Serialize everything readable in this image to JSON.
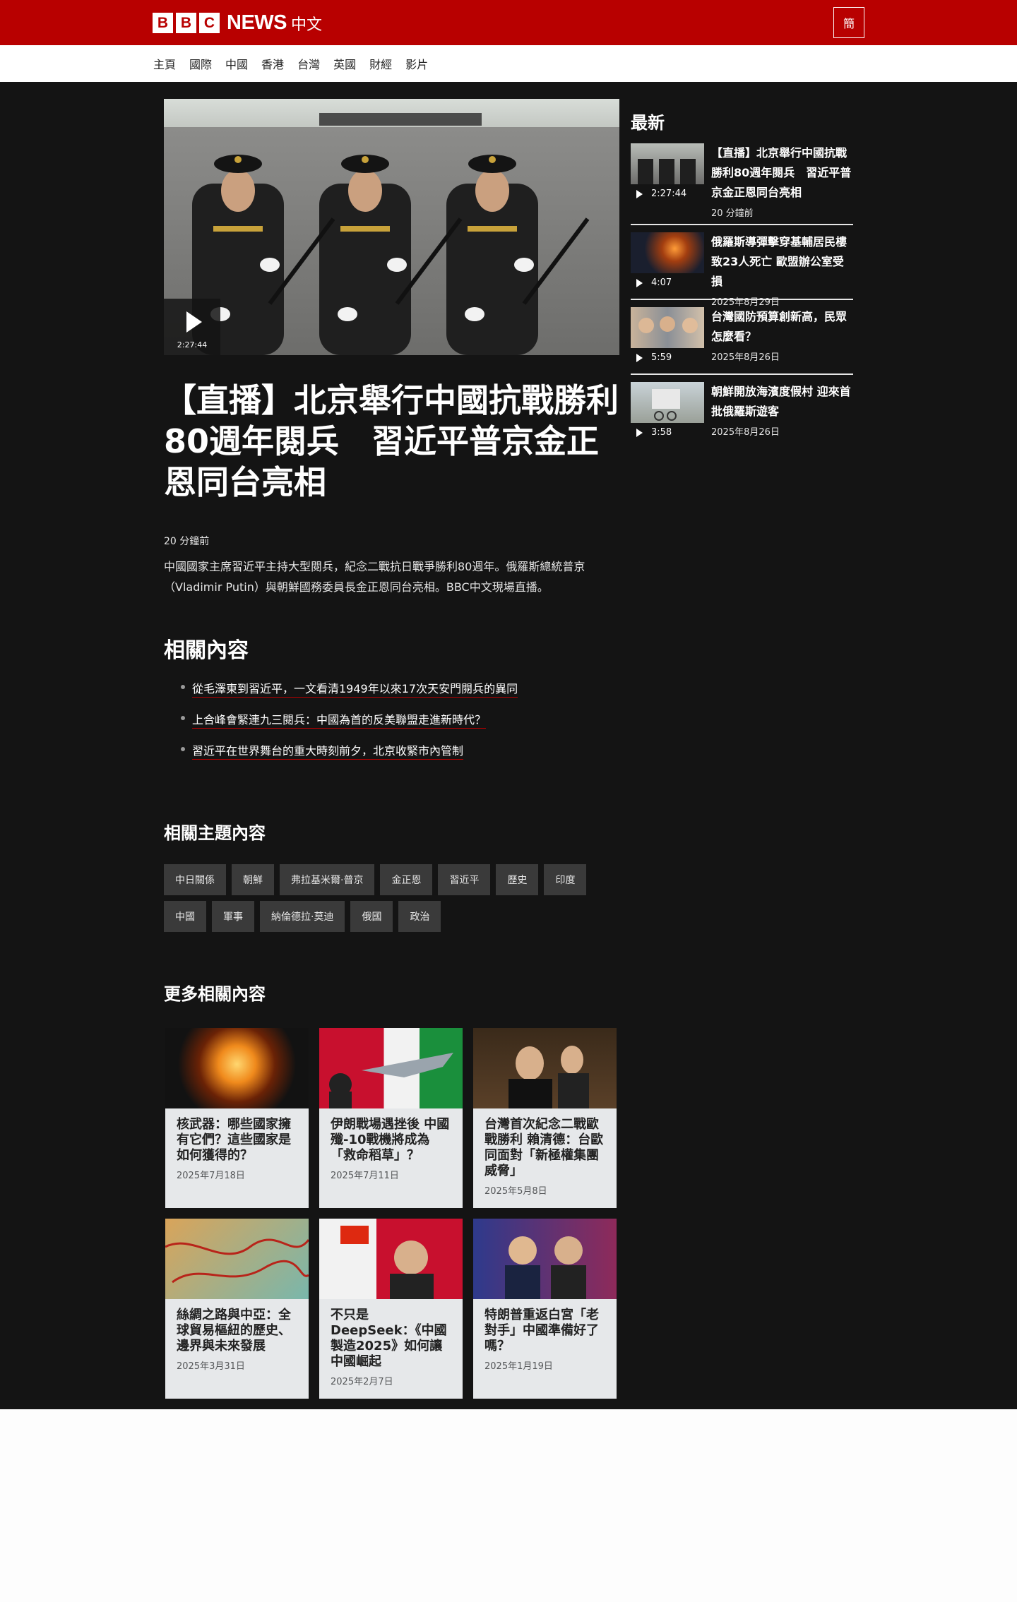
{
  "header": {
    "brand_letters": [
      "B",
      "B",
      "C"
    ],
    "brand_news": "NEWS",
    "brand_lang": "中文",
    "script_toggle": "簡"
  },
  "nav": {
    "items": [
      "主頁",
      "國際",
      "中國",
      "香港",
      "台灣",
      "英國",
      "財經",
      "影片"
    ]
  },
  "hero": {
    "duration": "2:27:44",
    "headline": "【直播】北京舉行中國抗戰勝利80週年閱兵　習近平普京金正恩同台亮相",
    "time_ago": "20 分鐘前",
    "summary": "中國國家主席習近平主持大型閱兵，紀念二戰抗日戰爭勝利80週年。俄羅斯總統普京（Vladimir Putin）與朝鮮國務委員長金正恩同台亮相。BBC中文現場直播。"
  },
  "related": {
    "heading": "相關內容",
    "items": [
      "從毛澤東到習近平，一文看清1949年以來17次天安門閱兵的異同",
      "上合峰會緊連九三閱兵：中國為首的反美聯盟走進新時代？",
      "習近平在世界舞台的重大時刻前夕，北京收緊市內管制"
    ]
  },
  "topics": {
    "heading": "相關主題內容",
    "rows": [
      [
        "中日關係",
        "朝鮮",
        "弗拉基米爾·普京",
        "金正恩",
        "習近平",
        "歷史",
        "印度"
      ],
      [
        "中國",
        "軍事",
        "納倫德拉·莫迪",
        "俄國",
        "政治"
      ]
    ]
  },
  "more": {
    "heading": "更多相關內容",
    "cards": [
      {
        "title": "核武器：哪些國家擁有它們？這些國家是如何獲得的？",
        "date": "2025年7月18日"
      },
      {
        "title": "伊朗戰場遇挫後 中國殲-10戰機將成為「救命稻草」？",
        "date": "2025年7月11日"
      },
      {
        "title": "台灣首次紀念二戰歐戰勝利 賴清德：台歐同面對「新極權集團威脅」",
        "date": "2025年5月8日"
      },
      {
        "title": "絲綢之路與中亞：全球貿易樞紐的歷史、邊界與未來發展",
        "date": "2025年3月31日"
      },
      {
        "title": "不只是DeepSeek：《中國製造2025》如何讓中國崛起",
        "date": "2025年2月7日"
      },
      {
        "title": "特朗普重返白宮「老對手」中國準備好了嗎？",
        "date": "2025年1月19日"
      }
    ]
  },
  "latest": {
    "heading": "最新",
    "items": [
      {
        "title": "【直播】北京舉行中國抗戰勝利80週年閱兵　習近平普京金正恩同台亮相",
        "duration": "2:27:44",
        "date": "20 分鐘前"
      },
      {
        "title": "俄羅斯導彈擊穿基輔居民樓致23人死亡 歐盟辦公室受損",
        "duration": "4:07",
        "date": "2025年8月29日"
      },
      {
        "title": "台灣國防預算創新高，民眾怎麼看？",
        "duration": "5:59",
        "date": "2025年8月26日"
      },
      {
        "title": "朝鮮開放海濱度假村 迎來首批俄羅斯遊客",
        "duration": "3:58",
        "date": "2025年8月26日"
      }
    ]
  }
}
